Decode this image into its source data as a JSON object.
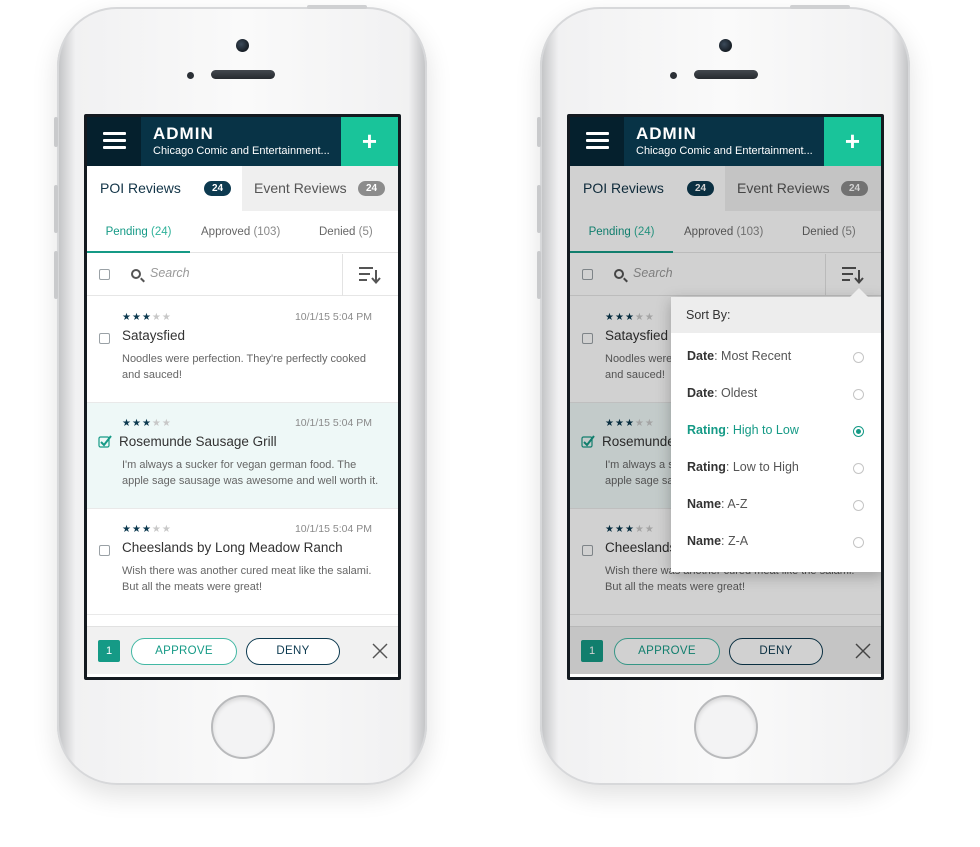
{
  "phones": [
    {
      "app": {
        "brand": "ADMIN",
        "event_name": "Chicago Comic and Entertainment...",
        "add_label": "+"
      },
      "tabs": [
        {
          "label": "POI Reviews",
          "count": "24"
        },
        {
          "label": "Event Reviews",
          "count": "24"
        }
      ],
      "subtabs": [
        {
          "label": "Pending",
          "count": "(24)"
        },
        {
          "label": "Approved",
          "count": "(103)"
        },
        {
          "label": "Denied",
          "count": "(5)"
        }
      ],
      "search": {
        "placeholder": "Search"
      },
      "reviews": [
        {
          "rating": 3,
          "date": "10/1/15 5:04 PM",
          "title": "Sataysfied",
          "text": "Noodles were perfection. They're perfectly cooked and sauced!",
          "selected": false
        },
        {
          "rating": 3,
          "date": "10/1/15 5:04 PM",
          "title": "Rosemunde Sausage Grill",
          "text": "I'm always a sucker for vegan german food. The apple sage sausage was awesome and well worth it.",
          "selected": true
        },
        {
          "rating": 3,
          "date": "10/1/15 5:04 PM",
          "title": "Cheeslands by Long Meadow Ranch",
          "text": "Wish there was another cured meat like the salami. But all the meats were great!",
          "selected": false
        }
      ],
      "actions": {
        "selected_count": "1",
        "approve": "APPROVE",
        "deny": "DENY"
      }
    },
    {
      "app": {
        "brand": "ADMIN",
        "event_name": "Chicago Comic and Entertainment...",
        "add_label": "+"
      },
      "tabs": [
        {
          "label": "POI Reviews",
          "count": "24"
        },
        {
          "label": "Event Reviews",
          "count": "24"
        }
      ],
      "subtabs": [
        {
          "label": "Pending",
          "count": "(24)"
        },
        {
          "label": "Approved",
          "count": "(103)"
        },
        {
          "label": "Denied",
          "count": "(5)"
        }
      ],
      "search": {
        "placeholder": "Search"
      },
      "reviews": [
        {
          "rating": 3,
          "date": "",
          "title": "Sataysfied",
          "text": "Noodles were perfection. They're perfectly cooked and sauced!",
          "selected": false
        },
        {
          "rating": 3,
          "date": "",
          "title": "Rosemunde Sausage Grill",
          "text": "I'm always a sucker for vegan german food. The apple sage sausage was awesome and well worth it.",
          "selected": true
        },
        {
          "rating": 3,
          "date": "",
          "title": "Cheeslands by Long Meadow Ranch",
          "text": "Wish there was another cured meat like the salami. But all the meats were great!",
          "selected": false
        }
      ],
      "actions": {
        "selected_count": "1",
        "approve": "APPROVE",
        "deny": "DENY"
      },
      "sort_menu": {
        "title": "Sort By:",
        "options": [
          {
            "field": "Date",
            "sep": ":",
            "value": "Most Recent",
            "selected": false
          },
          {
            "field": "Date",
            "sep": ":",
            "value": "Oldest",
            "selected": false
          },
          {
            "field": "Rating",
            "sep": ":",
            "value": "High to Low",
            "selected": true
          },
          {
            "field": "Rating",
            "sep": ":",
            "value": "Low to High",
            "selected": false
          },
          {
            "field": "Name",
            "sep": ":",
            "value": "A-Z",
            "selected": false
          },
          {
            "field": "Name",
            "sep": ":",
            "value": "Z-A",
            "selected": false
          }
        ]
      }
    }
  ],
  "colors": {
    "navy": "#083346",
    "teal": "#19c49a",
    "accent": "#159a86"
  }
}
